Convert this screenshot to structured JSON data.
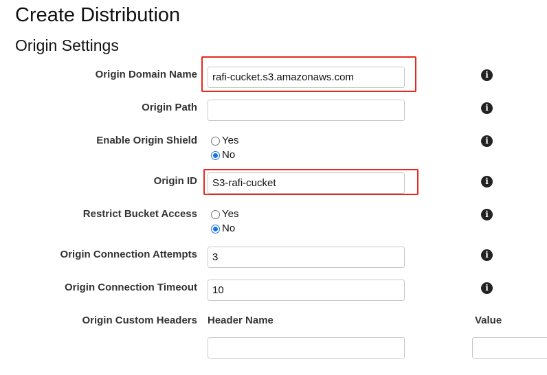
{
  "page": {
    "title": "Create Distribution",
    "section_title": "Origin Settings"
  },
  "fields": {
    "origin_domain_name": {
      "label": "Origin Domain Name",
      "value": "rafi-cucket.s3.amazonaws.com"
    },
    "origin_path": {
      "label": "Origin Path",
      "value": ""
    },
    "enable_origin_shield": {
      "label": "Enable Origin Shield",
      "options": [
        "Yes",
        "No"
      ],
      "selected": "No"
    },
    "origin_id": {
      "label": "Origin ID",
      "value": "S3-rafi-cucket"
    },
    "restrict_bucket_access": {
      "label": "Restrict Bucket Access",
      "options": [
        "Yes",
        "No"
      ],
      "selected": "No"
    },
    "origin_connection_attempts": {
      "label": "Origin Connection Attempts",
      "value": "3"
    },
    "origin_connection_timeout": {
      "label": "Origin Connection Timeout",
      "value": "10"
    },
    "origin_custom_headers": {
      "label": "Origin Custom Headers",
      "header_name_col": "Header Name",
      "value_col": "Value",
      "header_name_value": "",
      "value_value": ""
    }
  },
  "icons": {
    "info": "info-icon",
    "info_glyph": "i"
  },
  "colors": {
    "highlight": "#e8281e",
    "radio_checked": "#1a73e8"
  }
}
